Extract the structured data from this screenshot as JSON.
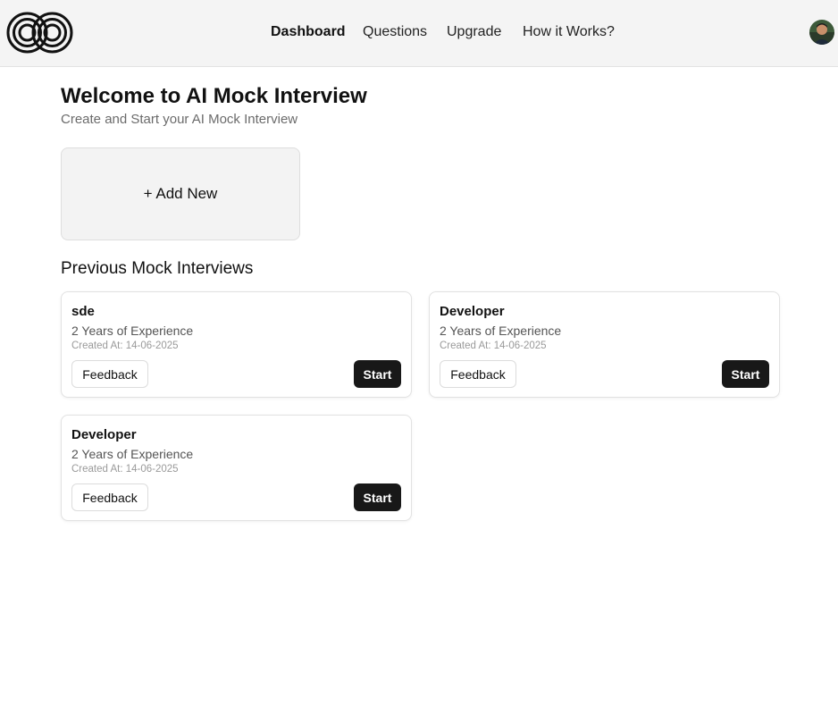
{
  "header": {
    "nav": [
      {
        "label": "Dashboard",
        "active": true
      },
      {
        "label": "Questions",
        "active": false
      },
      {
        "label": "Upgrade",
        "active": false
      },
      {
        "label": "How it Works?",
        "active": false
      }
    ],
    "logo_icon": "interlocking-loops-logo",
    "avatar_icon": "user-avatar"
  },
  "main": {
    "title": "Welcome to AI Mock Interview",
    "subtitle": "Create and Start your AI Mock Interview",
    "add_new_label": "+ Add New",
    "previous_title": "Previous Mock Interviews",
    "interviews": [
      {
        "role": "sde",
        "experience": "2 Years of Experience",
        "created": "Created At: 14-06-2025",
        "feedback_label": "Feedback",
        "start_label": "Start"
      },
      {
        "role": "Developer",
        "experience": "2 Years of Experience",
        "created": "Created At: 14-06-2025",
        "feedback_label": "Feedback",
        "start_label": "Start"
      },
      {
        "role": "Developer",
        "experience": "2 Years of Experience",
        "created": "Created At: 14-06-2025",
        "feedback_label": "Feedback",
        "start_label": "Start"
      }
    ]
  },
  "colors": {
    "header_bg": "#f4f4f4",
    "primary_button": "#181818",
    "muted_text": "#6b6b6b"
  }
}
